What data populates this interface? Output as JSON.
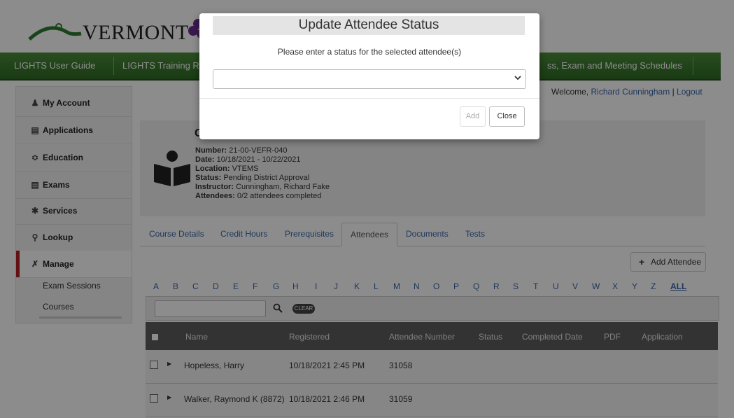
{
  "header": {
    "logo_text": "VERMONT",
    "nav": [
      "LIGHTS User Guide",
      "LIGHTS Training R",
      "ss, Exam and Meeting Schedules"
    ]
  },
  "sidebar": {
    "items": [
      {
        "label": "My Account",
        "icon": "person-icon"
      },
      {
        "label": "Applications",
        "icon": "form-icon"
      },
      {
        "label": "Education",
        "icon": "graduation-cap-icon"
      },
      {
        "label": "Exams",
        "icon": "form-icon"
      },
      {
        "label": "Services",
        "icon": "star-icon"
      },
      {
        "label": "Lookup",
        "icon": "search-icon"
      },
      {
        "label": "Manage",
        "icon": "wrench-icon"
      }
    ],
    "subitems": [
      "Exam Sessions",
      "Courses"
    ]
  },
  "welcome": {
    "prefix": "Welcome,",
    "user": "Richard Cunningham",
    "sep": "|",
    "logout": "Logout"
  },
  "course": {
    "title_initial": "C",
    "info": [
      {
        "label": "Number:",
        "value": "21-00-VEFR-040"
      },
      {
        "label": "Date:",
        "value": "10/18/2021 - 10/22/2021"
      },
      {
        "label": "Location:",
        "value": "VTEMS"
      },
      {
        "label": "Status:",
        "value": "Pending District Approval"
      },
      {
        "label": "Instructor:",
        "value": "Cunningham, Richard Fake"
      },
      {
        "label": "Attendees:",
        "value": "0/2 attendees completed"
      }
    ]
  },
  "tabs": [
    "Course Details",
    "Credit Hours",
    "Prerequisites",
    "Attendees",
    "Documents",
    "Tests"
  ],
  "active_tab": "Attendees",
  "add_attendee_label": "Add Attendee",
  "alphabet": [
    "A",
    "B",
    "C",
    "D",
    "E",
    "F",
    "G",
    "H",
    "I",
    "J",
    "K",
    "L",
    "M",
    "N",
    "O",
    "P",
    "Q",
    "R",
    "S",
    "T",
    "U",
    "V",
    "W",
    "X",
    "Y",
    "Z",
    "ALL"
  ],
  "clear_label": "CLEAR",
  "table": {
    "headers": [
      "Name",
      "Registered",
      "Attendee Number",
      "Status",
      "Completed Date",
      "PDF",
      "Application"
    ],
    "rows": [
      {
        "name": "Hopeless, Harry",
        "registered": "10/18/2021 2:45 PM",
        "number": "31058"
      },
      {
        "name": "Walker, Raymond K (8872)",
        "registered": "10/18/2021 2:46 PM",
        "number": "31059"
      }
    ]
  },
  "modal": {
    "title": "Update Attendee Status",
    "message": "Please enter a status for the selected attendee(s)",
    "select_value": "",
    "add_label": "Add",
    "close_label": "Close"
  },
  "colors": {
    "nav_green": "#3d7a2f",
    "link_blue": "#3a66a8",
    "active_red": "#b22222"
  }
}
